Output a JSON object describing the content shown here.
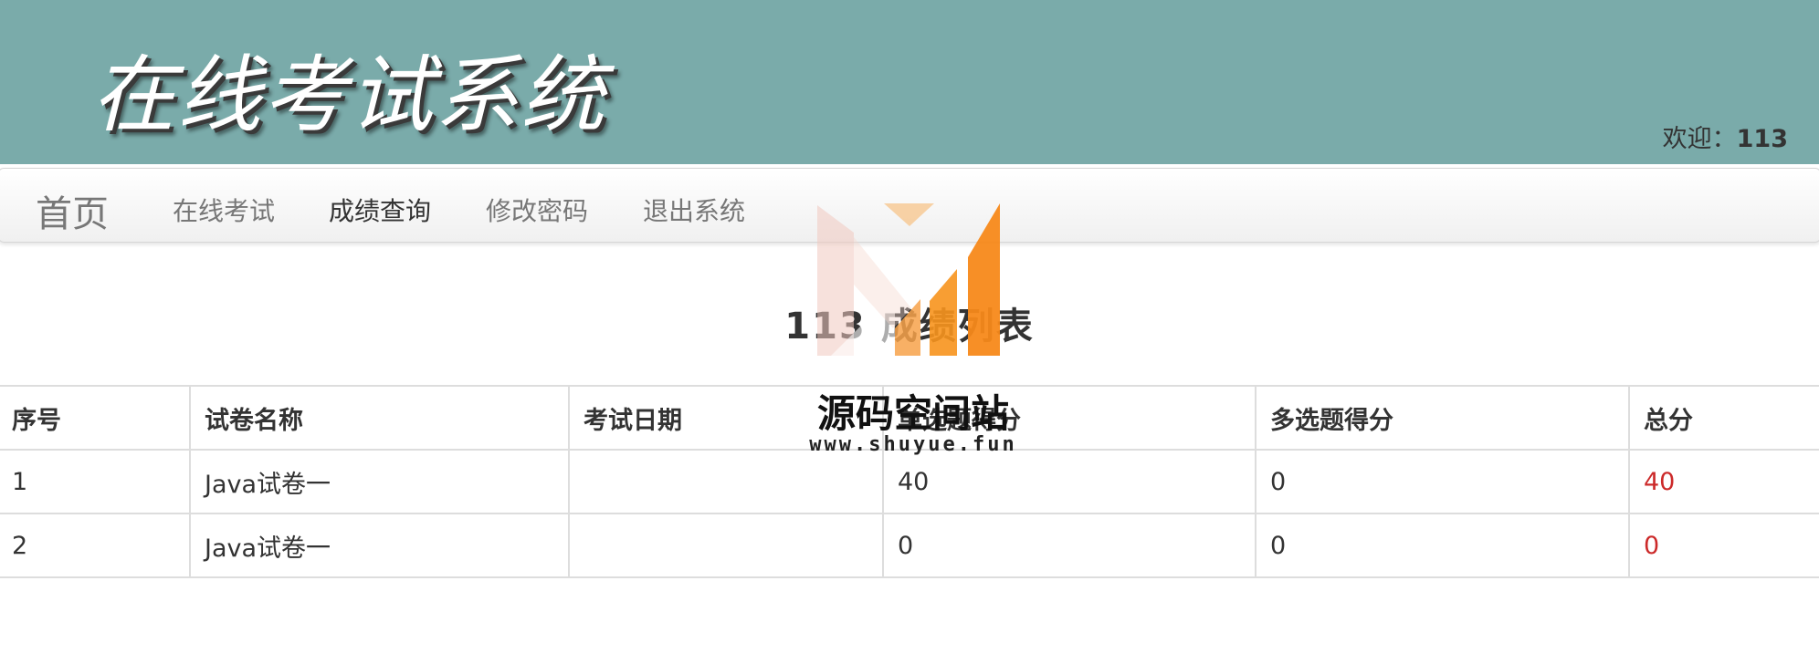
{
  "header": {
    "system_title": "在线考试系统",
    "welcome_label": "欢迎：",
    "welcome_user": "113"
  },
  "nav": {
    "brand": "首页",
    "items": [
      {
        "label": "在线考试"
      },
      {
        "label": "成绩查询",
        "active": true
      },
      {
        "label": "修改密码"
      },
      {
        "label": "退出系统"
      }
    ]
  },
  "page": {
    "heading": "113 成绩列表"
  },
  "table": {
    "headers": [
      "序号",
      "试卷名称",
      "考试日期",
      "单选题得分",
      "多选题得分",
      "总分"
    ],
    "rows": [
      [
        "1",
        "Java试卷一",
        "",
        "40",
        "0",
        "40"
      ],
      [
        "2",
        "Java试卷一",
        "",
        "0",
        "0",
        "0"
      ]
    ]
  },
  "watermark": {
    "title": "源码空间站",
    "url": "www.shuyue.fun"
  },
  "colors": {
    "header_bg": "#7aabaa",
    "total_score": "#cc2a2a",
    "watermark_orange": "#f7941d"
  }
}
